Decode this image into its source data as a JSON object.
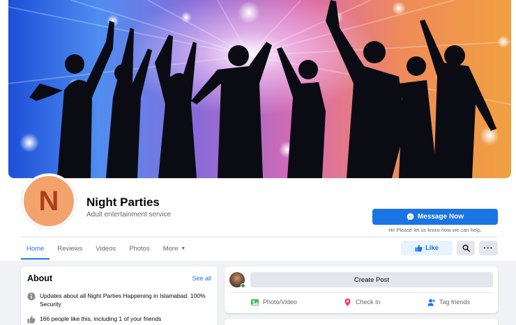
{
  "page": {
    "avatar_letter": "N",
    "name": "Night Parties",
    "category": "Adult entertainment service",
    "message_button": "Message Now",
    "message_hint": "Hi! Please let us know how we can help."
  },
  "tabs": [
    {
      "label": "Home",
      "active": true
    },
    {
      "label": "Reviews"
    },
    {
      "label": "Videos"
    },
    {
      "label": "Photos"
    },
    {
      "label": "More"
    }
  ],
  "actions": {
    "like_label": "Like",
    "more_dots": "···"
  },
  "about": {
    "title": "About",
    "see_all": "See all",
    "description": "Updates about all Night Parties Happening in Islamabad. 100% Security",
    "likes_text": "166 people like this, including 1 of your friends"
  },
  "composer": {
    "create_post": "Create Post",
    "photo_video": "Photo/Video",
    "check_in": "Check In",
    "tag_friends": "Tag friends"
  },
  "colors": {
    "accent": "#1b74e4",
    "avatar_bg": "#f4a26b",
    "avatar_letter": "#a8401a",
    "online": "#31a24c"
  },
  "icons": [
    "messenger-icon",
    "thumbs-up-icon",
    "search-icon",
    "info-icon",
    "photo-icon",
    "location-pin-icon",
    "tag-friends-icon",
    "chevron-down-icon"
  ]
}
